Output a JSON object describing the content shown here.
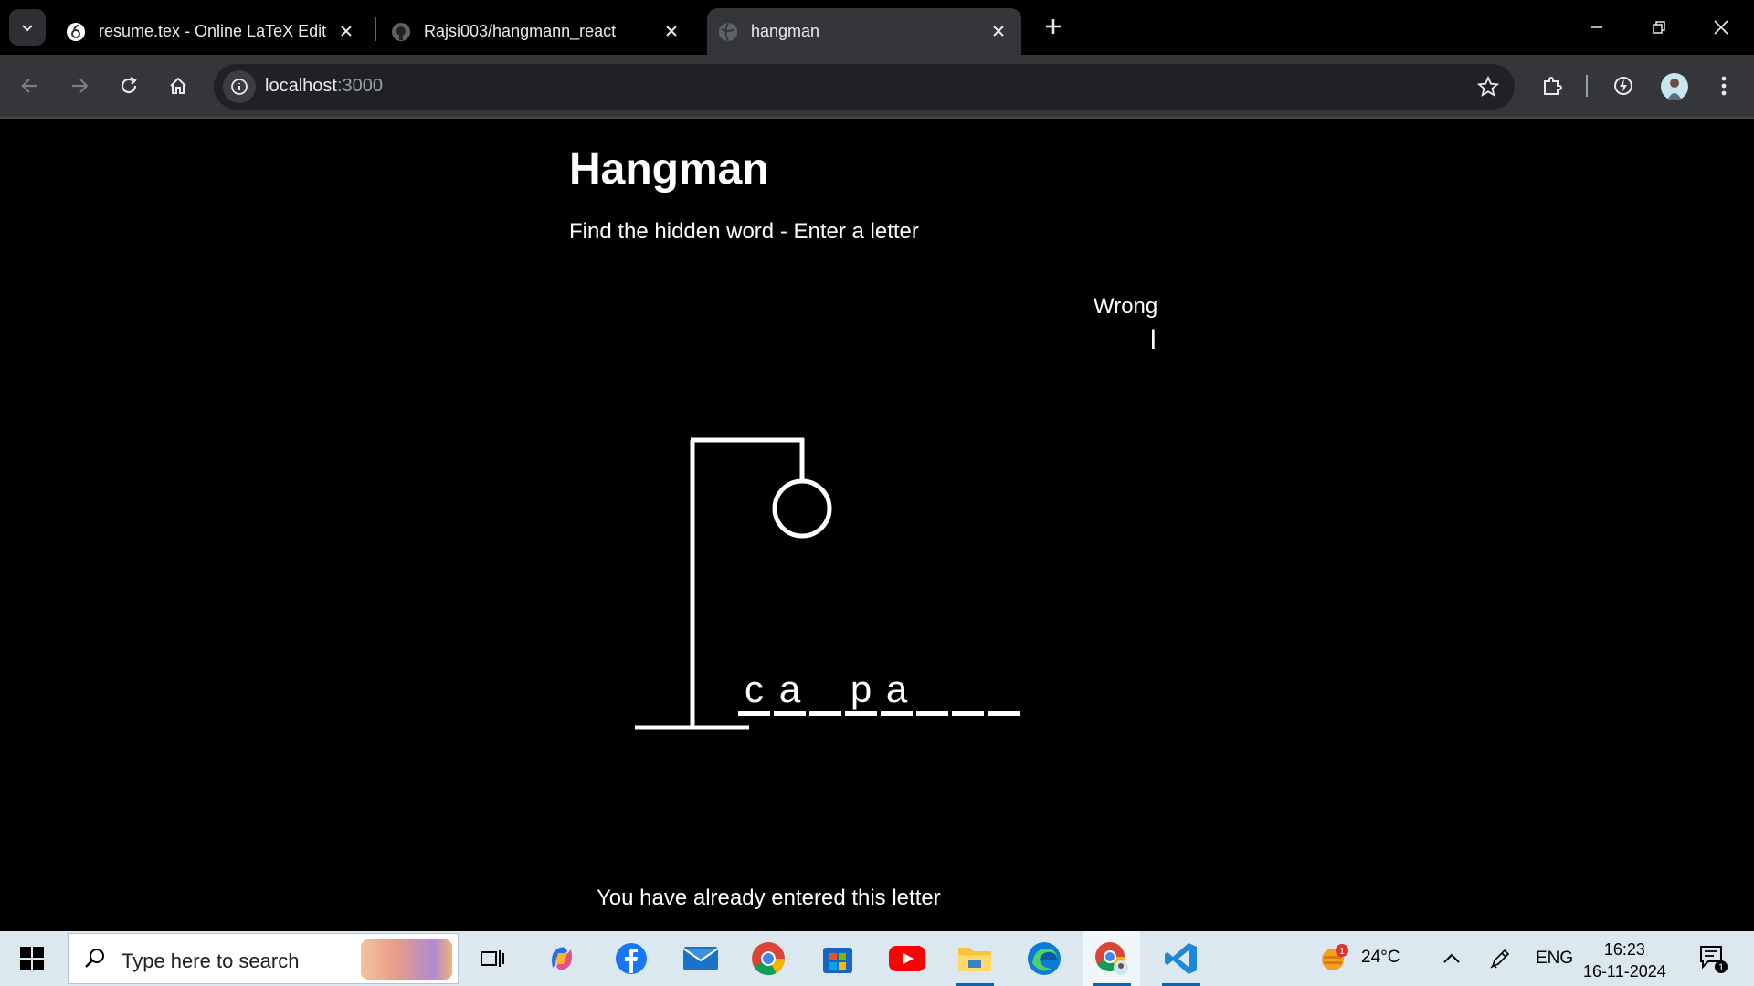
{
  "browser": {
    "tabs": [
      {
        "title": "resume.tex - Online LaTeX Edito",
        "icon": "overleaf-icon",
        "active": false
      },
      {
        "title": "Rajsi003/hangmann_react",
        "icon": "github-icon",
        "active": false
      },
      {
        "title": "hangman",
        "icon": "globe-icon",
        "active": true
      }
    ],
    "address": {
      "host": "localhost",
      "port": ":3000"
    }
  },
  "page": {
    "title": "Hangman",
    "subtitle": "Find the hidden word - Enter a letter",
    "wrong_label": "Wrong",
    "wrong_letters": [
      "l"
    ],
    "word_slots": [
      "c",
      "a",
      "",
      "p",
      "a",
      "",
      "",
      ""
    ],
    "notification": "You have already entered this letter"
  },
  "taskbar": {
    "search_placeholder": "Type here to search",
    "weather": {
      "temp": "24°C",
      "badge": "1"
    },
    "language": "ENG",
    "time": "16:23",
    "date": "16-11-2024",
    "notification_count": "1"
  },
  "colors": {
    "page_bg": "#000000",
    "chrome": "#35363a",
    "taskbar": "#dbe8f0"
  }
}
